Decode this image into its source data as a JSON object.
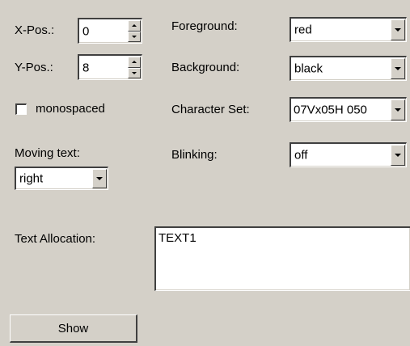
{
  "xpos": {
    "label": "X-Pos.:",
    "value": "0"
  },
  "ypos": {
    "label": "Y-Pos.:",
    "value": "8"
  },
  "monospaced": {
    "label": "monospaced",
    "checked": false
  },
  "moving_text": {
    "label": "Moving text:",
    "value": "right"
  },
  "foreground": {
    "label": "Foreground:",
    "value": "red"
  },
  "background": {
    "label": "Background:",
    "value": "black"
  },
  "character_set": {
    "label": "Character Set:",
    "value": "07Vx05H 050"
  },
  "blinking": {
    "label": "Blinking:",
    "value": "off"
  },
  "text_allocation": {
    "label": "Text Allocation:",
    "value": "TEXT1"
  },
  "show_button": {
    "label": "Show"
  },
  "icons": {
    "spin_up": "spin-up-arrow",
    "spin_down": "spin-down-arrow",
    "dropdown": "dropdown-arrow"
  }
}
